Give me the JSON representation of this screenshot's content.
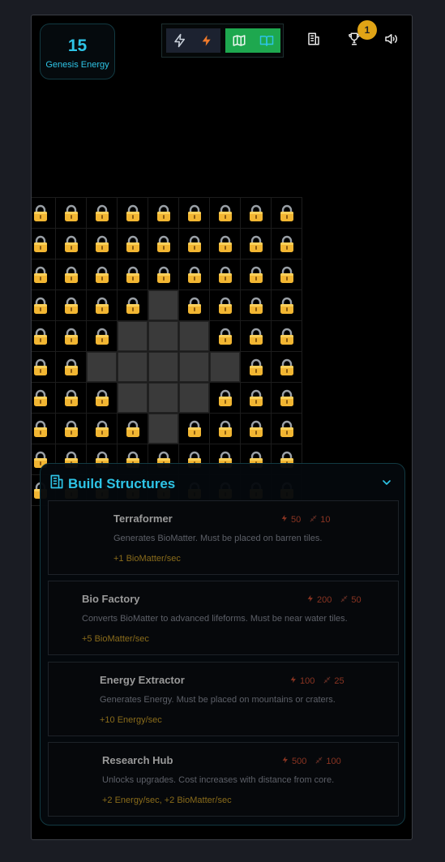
{
  "hud": {
    "energy_value": "15",
    "energy_label": "Genesis Energy",
    "achievements_count": "1"
  },
  "toolbar": {
    "icons": [
      "zap-outline-icon",
      "zap-filled-icon",
      "map-icon",
      "book-open-icon"
    ],
    "right_icons": [
      "building-icon",
      "trophy-icon",
      "volume-icon"
    ]
  },
  "grid": {
    "columns": 9,
    "rows": 10,
    "open_tiles": [
      [
        3,
        4
      ],
      [
        4,
        3
      ],
      [
        4,
        4
      ],
      [
        4,
        5
      ],
      [
        5,
        2
      ],
      [
        5,
        3
      ],
      [
        5,
        4
      ],
      [
        5,
        5
      ],
      [
        5,
        6
      ],
      [
        6,
        3
      ],
      [
        6,
        4
      ],
      [
        6,
        5
      ],
      [
        7,
        4
      ]
    ]
  },
  "panel": {
    "title": "Build Structures",
    "structures": [
      {
        "name": "Terraformer",
        "energy_cost": "50",
        "biomatter_cost": "10",
        "description": "Generates BioMatter. Must be placed on barren tiles.",
        "yield": "+1 BioMatter/sec"
      },
      {
        "name": "Bio Factory",
        "energy_cost": "200",
        "biomatter_cost": "50",
        "description": "Converts BioMatter to advanced lifeforms. Must be near water tiles.",
        "yield": "+5 BioMatter/sec"
      },
      {
        "name": "Energy Extractor",
        "energy_cost": "100",
        "biomatter_cost": "25",
        "description": "Generates Energy. Must be placed on mountains or craters.",
        "yield": "+10 Energy/sec"
      },
      {
        "name": "Research Hub",
        "energy_cost": "500",
        "biomatter_cost": "100",
        "description": "Unlocks upgrades. Cost increases with distance from core.",
        "yield": "+2 Energy/sec, +2 BioMatter/sec"
      }
    ]
  },
  "colors": {
    "accent": "#2ec4e6",
    "map_active": "#1ea84f",
    "lock": "#f2b632",
    "badge": "#e0a416"
  }
}
